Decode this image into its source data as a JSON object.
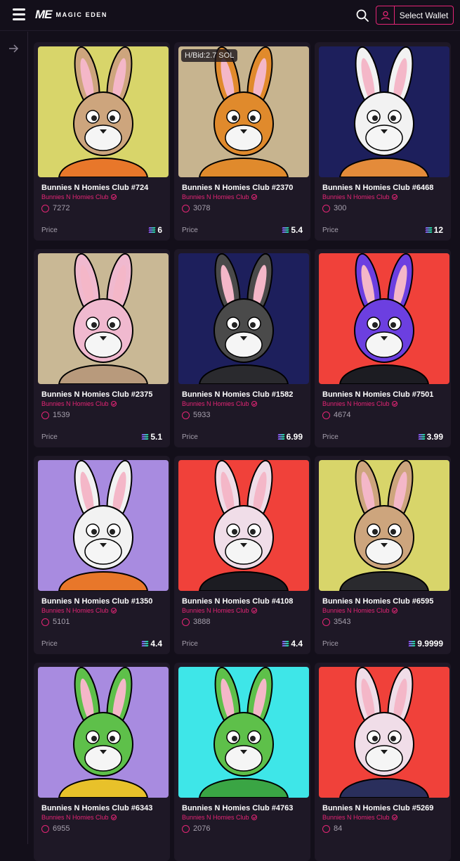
{
  "header": {
    "logo_mark": "ME",
    "logo_text": "MAGIC EDEN",
    "wallet_label": "Select Wallet"
  },
  "price_label": "Price",
  "items": [
    {
      "name": "Bunnies N Homies Club #724",
      "collection": "Bunnies N Homies Club",
      "rank": "7272",
      "price": "6",
      "bid": "",
      "bg": "#d8d56a",
      "ear": "#cda57d",
      "body": "#e8772a"
    },
    {
      "name": "Bunnies N Homies Club #2370",
      "collection": "Bunnies N Homies Club",
      "rank": "3078",
      "price": "5.4",
      "bid": "H/Bid:2.7 SOL",
      "bg": "#c7b48f",
      "ear": "#e08a2c",
      "body": "#e08a2c"
    },
    {
      "name": "Bunnies N Homies Club #6468",
      "collection": "Bunnies N Homies Club",
      "rank": "300",
      "price": "12",
      "bid": "",
      "bg": "#1d1f5c",
      "ear": "#f2f2f2",
      "body": "#e48b3a"
    },
    {
      "name": "Bunnies N Homies Club #2375",
      "collection": "Bunnies N Homies Club",
      "rank": "1539",
      "price": "5.1",
      "bid": "",
      "bg": "#c9b895",
      "ear": "#f0b9cf",
      "body": "#b89a7c"
    },
    {
      "name": "Bunnies N Homies Club #1582",
      "collection": "Bunnies N Homies Club",
      "rank": "5933",
      "price": "6.99",
      "bid": "",
      "bg": "#1d1f5c",
      "ear": "#4a4a4a",
      "body": "#2a2a2e"
    },
    {
      "name": "Bunnies N Homies Club #7501",
      "collection": "Bunnies N Homies Club",
      "rank": "4674",
      "price": "3.99",
      "bid": "",
      "bg": "#f0413a",
      "ear": "#6c3fe0",
      "body": "#1c1c22"
    },
    {
      "name": "Bunnies N Homies Club #1350",
      "collection": "Bunnies N Homies Club",
      "rank": "5101",
      "price": "4.4",
      "bid": "",
      "bg": "#a88be0",
      "ear": "#f2f2f2",
      "body": "#e8772a"
    },
    {
      "name": "Bunnies N Homies Club #4108",
      "collection": "Bunnies N Homies Club",
      "rank": "3888",
      "price": "4.4",
      "bid": "",
      "bg": "#f0413a",
      "ear": "#f0dde8",
      "body": "#1c1c22"
    },
    {
      "name": "Bunnies N Homies Club #6595",
      "collection": "Bunnies N Homies Club",
      "rank": "3543",
      "price": "9.9999",
      "bid": "",
      "bg": "#d8d56a",
      "ear": "#cda57d",
      "body": "#2a2a2e"
    },
    {
      "name": "Bunnies N Homies Club #6343",
      "collection": "Bunnies N Homies Club",
      "rank": "6955",
      "price": "",
      "bid": "",
      "bg": "#a88be0",
      "ear": "#5ec04a",
      "body": "#e8c12a"
    },
    {
      "name": "Bunnies N Homies Club #4763",
      "collection": "Bunnies N Homies Club",
      "rank": "2076",
      "price": "",
      "bid": "",
      "bg": "#3ee6e8",
      "ear": "#5ec04a",
      "body": "#3aa544"
    },
    {
      "name": "Bunnies N Homies Club #5269",
      "collection": "Bunnies N Homies Club",
      "rank": "84",
      "price": "",
      "bid": "",
      "bg": "#f0413a",
      "ear": "#f0dde8",
      "body": "#2a2f5c"
    }
  ]
}
